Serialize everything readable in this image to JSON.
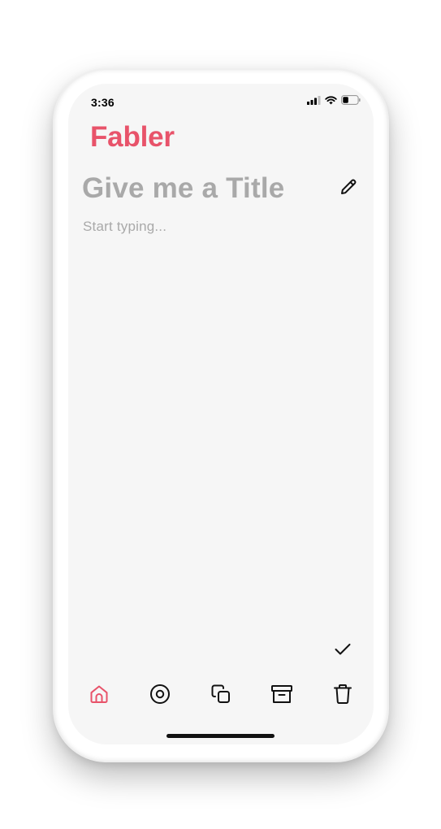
{
  "status_bar": {
    "time": "3:36",
    "icons": [
      "signal-icon",
      "wifi-icon",
      "battery-icon"
    ]
  },
  "app": {
    "name": "Fabler",
    "accent_color": "#e8536a"
  },
  "note": {
    "title_placeholder": "Give me a Title",
    "body_placeholder": "Start typing...",
    "placeholder_color": "#a9a9a9"
  },
  "actions": {
    "edit_icon": "pencil-icon",
    "confirm_icon": "checkmark-icon"
  },
  "bottom_nav": {
    "items": [
      {
        "icon": "home-icon",
        "active": true
      },
      {
        "icon": "record-icon",
        "active": false
      },
      {
        "icon": "copy-icon",
        "active": false
      },
      {
        "icon": "archive-icon",
        "active": false
      },
      {
        "icon": "trash-icon",
        "active": false
      }
    ]
  }
}
